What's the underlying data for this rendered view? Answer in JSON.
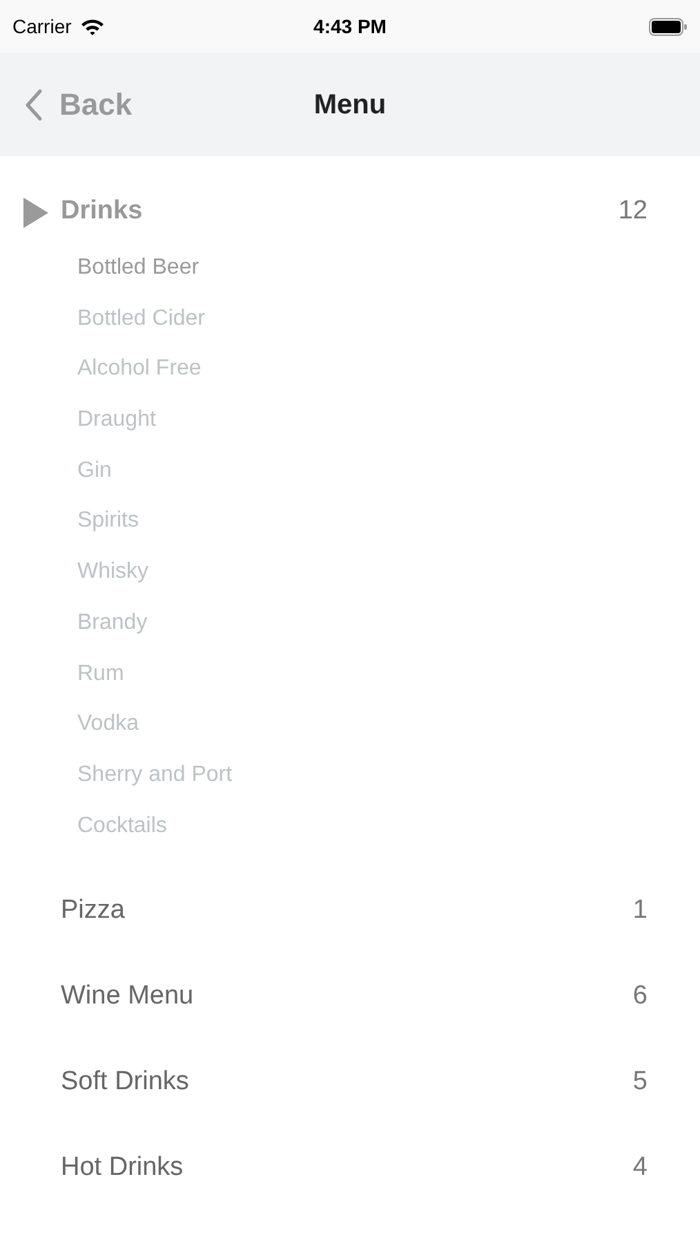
{
  "status_bar": {
    "carrier": "Carrier",
    "time": "4:43 PM"
  },
  "nav_bar": {
    "back": "Back",
    "title": "Menu"
  },
  "categories": [
    {
      "name": "Drinks",
      "count": "12",
      "expanded": true,
      "children": [
        {
          "name": "Bottled Beer",
          "selected": true
        },
        {
          "name": "Bottled Cider",
          "selected": false
        },
        {
          "name": "Alcohol Free",
          "selected": false
        },
        {
          "name": "Draught",
          "selected": false
        },
        {
          "name": "Gin",
          "selected": false
        },
        {
          "name": "Spirits",
          "selected": false
        },
        {
          "name": "Whisky",
          "selected": false
        },
        {
          "name": "Brandy",
          "selected": false
        },
        {
          "name": "Rum",
          "selected": false
        },
        {
          "name": "Vodka",
          "selected": false
        },
        {
          "name": "Sherry and Port",
          "selected": false
        },
        {
          "name": "Cocktails",
          "selected": false
        }
      ]
    },
    {
      "name": "Pizza",
      "count": "1",
      "expanded": false
    },
    {
      "name": "Wine Menu",
      "count": "6",
      "expanded": false
    },
    {
      "name": "Soft Drinks",
      "count": "5",
      "expanded": false
    },
    {
      "name": "Hot Drinks",
      "count": "4",
      "expanded": false
    }
  ]
}
